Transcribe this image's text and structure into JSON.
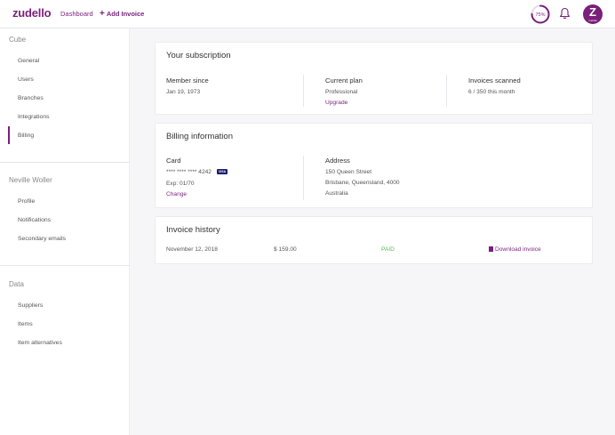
{
  "header": {
    "logo": "zudello",
    "nav_dashboard": "Dashboard",
    "nav_add_invoice": "Add Invoice",
    "progress_label": "75%",
    "progress_value": 0.75,
    "avatar_letter": "Z",
    "avatar_sub": "zudello",
    "accent_color": "#7a1f7a"
  },
  "sidebar": {
    "sections": [
      {
        "title": "Cube",
        "items": [
          "General",
          "Users",
          "Branches",
          "Integrations",
          "Billing"
        ]
      },
      {
        "title": "Neville Woller",
        "items": [
          "Profile",
          "Notifications",
          "Secondary emails"
        ]
      },
      {
        "title": "Data",
        "items": [
          "Suppliers",
          "Items",
          "Item alternatives"
        ]
      }
    ],
    "active_item": "Billing"
  },
  "subscription": {
    "title": "Your subscription",
    "member_since_label": "Member since",
    "member_since_value": "Jan 19, 1973",
    "plan_label": "Current plan",
    "plan_value": "Professional",
    "upgrade_link": "Upgrade",
    "scanned_label": "Invoices scanned",
    "scanned_value": "6 / 350 this month"
  },
  "billing": {
    "title": "Billing information",
    "card_label": "Card",
    "card_number": "**** **** **** 4242",
    "card_brand": "VISA",
    "card_expiry": "Exp: 01/70",
    "change_link": "Change",
    "address_label": "Address",
    "address_lines": [
      "150 Queen Street",
      "Brisbane, Queensland, 4000",
      "Australia"
    ]
  },
  "history": {
    "title": "Invoice history",
    "rows": [
      {
        "date": "November 12, 2018",
        "amount": "$ 159.00",
        "status": "PAID",
        "action": "Download invoice"
      }
    ]
  }
}
